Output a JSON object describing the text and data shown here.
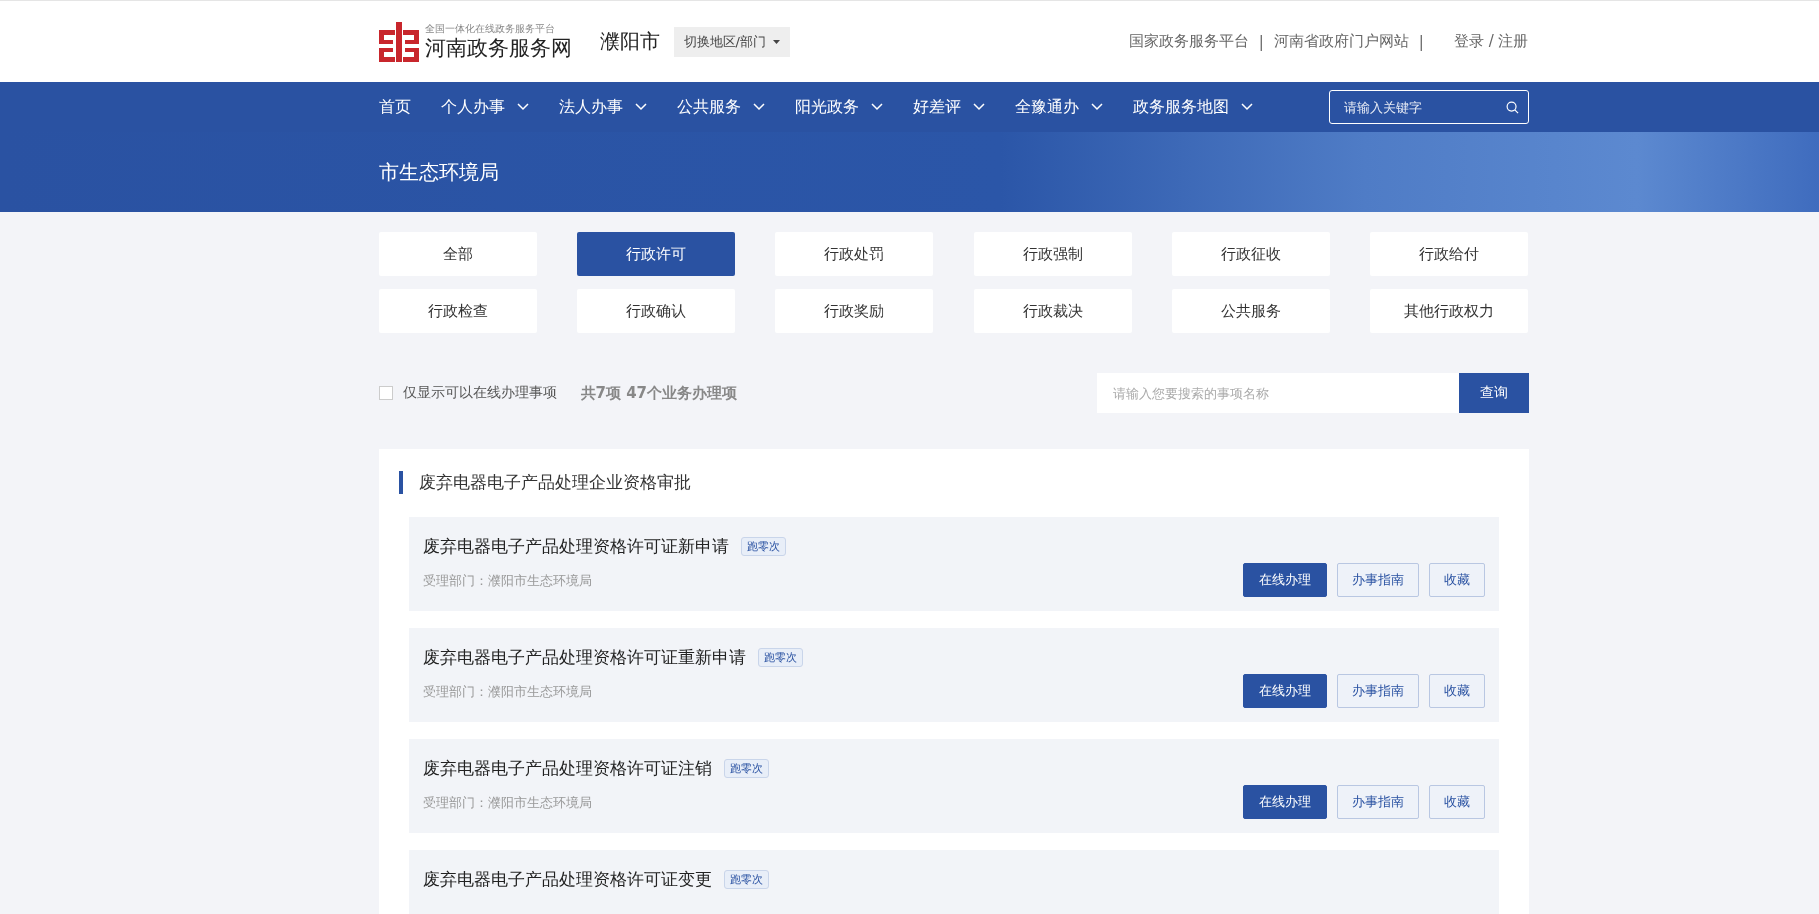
{
  "header": {
    "slogan": "全国一体化在线政务服务平台",
    "site_name": "河南政务服务网",
    "city": "濮阳市",
    "switch_label": "切换地区/部门",
    "links": [
      "国家政务服务平台",
      "|",
      "河南省政府门户网站",
      "|"
    ],
    "login": "登录 / 注册"
  },
  "nav": {
    "items": [
      {
        "label": "首页",
        "dropdown": false
      },
      {
        "label": "个人办事",
        "dropdown": true
      },
      {
        "label": "法人办事",
        "dropdown": true
      },
      {
        "label": "公共服务",
        "dropdown": true
      },
      {
        "label": "阳光政务",
        "dropdown": true
      },
      {
        "label": "好差评",
        "dropdown": true
      },
      {
        "label": "全豫通办",
        "dropdown": true
      },
      {
        "label": "政务服务地图",
        "dropdown": true
      }
    ],
    "search_placeholder": "请输入关键字"
  },
  "banner": {
    "title": "市生态环境局"
  },
  "categories": [
    {
      "label": "全部",
      "selected": false
    },
    {
      "label": "行政许可",
      "selected": true
    },
    {
      "label": "行政处罚",
      "selected": false
    },
    {
      "label": "行政强制",
      "selected": false
    },
    {
      "label": "行政征收",
      "selected": false
    },
    {
      "label": "行政给付",
      "selected": false
    },
    {
      "label": "行政检查",
      "selected": false
    },
    {
      "label": "行政确认",
      "selected": false
    },
    {
      "label": "行政奖励",
      "selected": false
    },
    {
      "label": "行政裁决",
      "selected": false
    },
    {
      "label": "公共服务",
      "selected": false
    },
    {
      "label": "其他行政权力",
      "selected": false
    }
  ],
  "filter": {
    "online_only_label": "仅显示可以在线办理事项",
    "online_only": false,
    "summary": "共7项 47个业务办理项",
    "search_placeholder": "请输入您要搜索的事项名称",
    "search_button": "查询"
  },
  "group": {
    "title": "废弃电器电子产品处理企业资格审批",
    "items": [
      {
        "name": "废弃电器电子产品处理资格许可证新申请",
        "tag": "跑零次",
        "department": "受理部门：濮阳市生态环境局",
        "actions": [
          "在线办理",
          "办事指南",
          "收藏"
        ]
      },
      {
        "name": "废弃电器电子产品处理资格许可证重新申请",
        "tag": "跑零次",
        "department": "受理部门：濮阳市生态环境局",
        "actions": [
          "在线办理",
          "办事指南",
          "收藏"
        ]
      },
      {
        "name": "废弃电器电子产品处理资格许可证注销",
        "tag": "跑零次",
        "department": "受理部门：濮阳市生态环境局",
        "actions": [
          "在线办理",
          "办事指南",
          "收藏"
        ]
      },
      {
        "name": "废弃电器电子产品处理资格许可证变更",
        "tag": "跑零次"
      }
    ]
  }
}
